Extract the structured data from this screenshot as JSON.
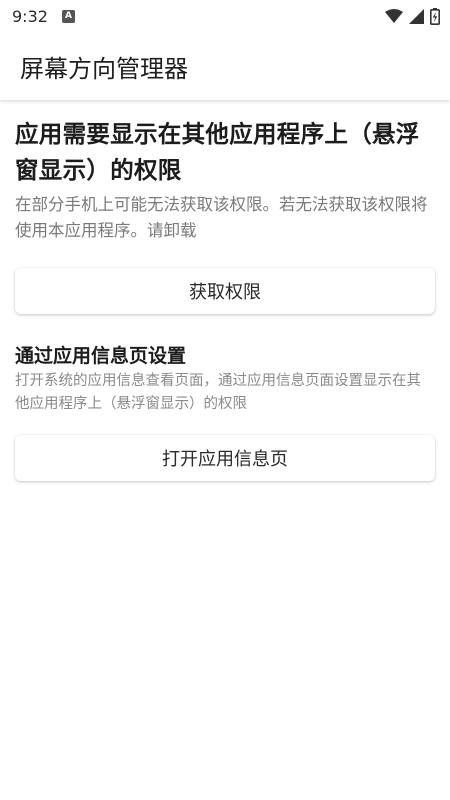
{
  "status_bar": {
    "time": "9:32",
    "notification_badge": "A",
    "icons": [
      "wifi-icon",
      "cell-signal-icon",
      "battery-charging-icon"
    ]
  },
  "app_bar": {
    "title": "屏幕方向管理器"
  },
  "permission_section": {
    "heading": "应用需要显示在其他应用程序上（悬浮窗显示）的权限",
    "description": "在部分手机上可能无法获取该权限。若无法获取该权限将使用本应用程序。请卸载",
    "button_label": "获取权限"
  },
  "app_info_section": {
    "heading": "通过应用信息页设置",
    "description": "打开系统的应用信息查看页面，通过应用信息页面设置显示在其他应用程序上（悬浮窗显示）的权限",
    "button_label": "打开应用信息页"
  },
  "colors": {
    "background": "#ffffff",
    "primary_text": "#1f1f1f",
    "secondary_text": "#7a7a7a"
  }
}
